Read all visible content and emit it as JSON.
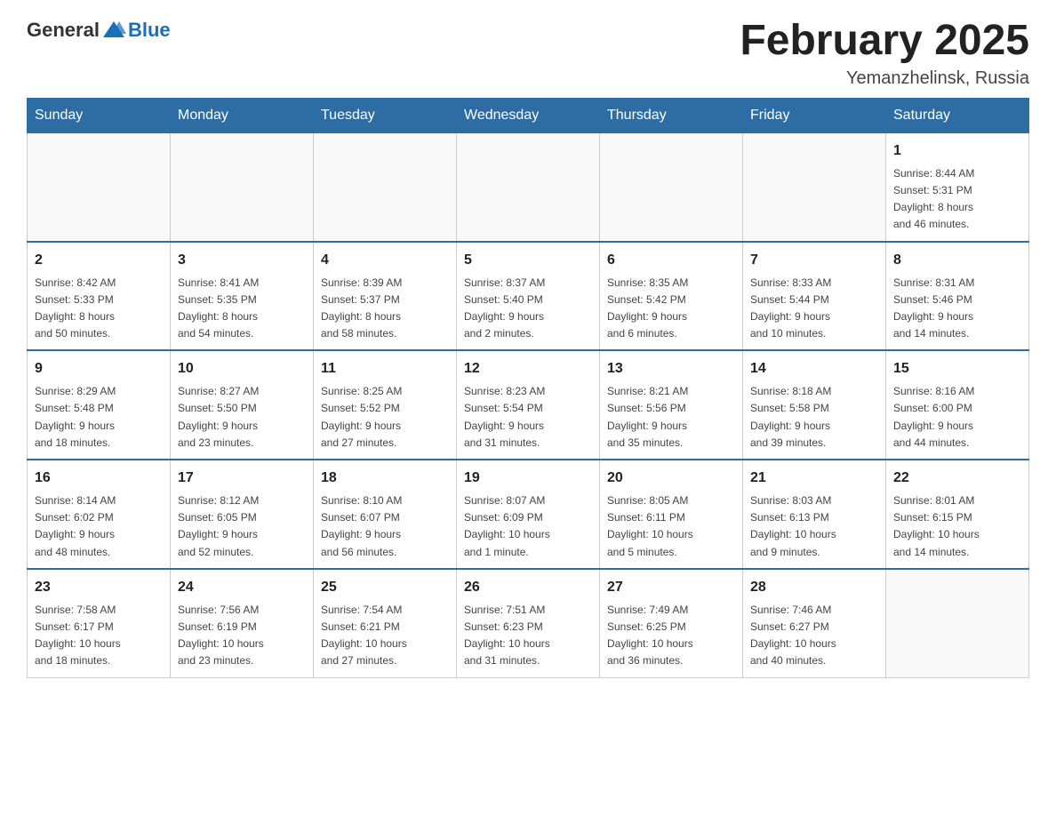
{
  "logo": {
    "general": "General",
    "blue": "Blue"
  },
  "header": {
    "month_title": "February 2025",
    "location": "Yemanzhelinsk, Russia"
  },
  "weekdays": [
    "Sunday",
    "Monday",
    "Tuesday",
    "Wednesday",
    "Thursday",
    "Friday",
    "Saturday"
  ],
  "weeks": [
    [
      {
        "day": "",
        "info": ""
      },
      {
        "day": "",
        "info": ""
      },
      {
        "day": "",
        "info": ""
      },
      {
        "day": "",
        "info": ""
      },
      {
        "day": "",
        "info": ""
      },
      {
        "day": "",
        "info": ""
      },
      {
        "day": "1",
        "info": "Sunrise: 8:44 AM\nSunset: 5:31 PM\nDaylight: 8 hours\nand 46 minutes."
      }
    ],
    [
      {
        "day": "2",
        "info": "Sunrise: 8:42 AM\nSunset: 5:33 PM\nDaylight: 8 hours\nand 50 minutes."
      },
      {
        "day": "3",
        "info": "Sunrise: 8:41 AM\nSunset: 5:35 PM\nDaylight: 8 hours\nand 54 minutes."
      },
      {
        "day": "4",
        "info": "Sunrise: 8:39 AM\nSunset: 5:37 PM\nDaylight: 8 hours\nand 58 minutes."
      },
      {
        "day": "5",
        "info": "Sunrise: 8:37 AM\nSunset: 5:40 PM\nDaylight: 9 hours\nand 2 minutes."
      },
      {
        "day": "6",
        "info": "Sunrise: 8:35 AM\nSunset: 5:42 PM\nDaylight: 9 hours\nand 6 minutes."
      },
      {
        "day": "7",
        "info": "Sunrise: 8:33 AM\nSunset: 5:44 PM\nDaylight: 9 hours\nand 10 minutes."
      },
      {
        "day": "8",
        "info": "Sunrise: 8:31 AM\nSunset: 5:46 PM\nDaylight: 9 hours\nand 14 minutes."
      }
    ],
    [
      {
        "day": "9",
        "info": "Sunrise: 8:29 AM\nSunset: 5:48 PM\nDaylight: 9 hours\nand 18 minutes."
      },
      {
        "day": "10",
        "info": "Sunrise: 8:27 AM\nSunset: 5:50 PM\nDaylight: 9 hours\nand 23 minutes."
      },
      {
        "day": "11",
        "info": "Sunrise: 8:25 AM\nSunset: 5:52 PM\nDaylight: 9 hours\nand 27 minutes."
      },
      {
        "day": "12",
        "info": "Sunrise: 8:23 AM\nSunset: 5:54 PM\nDaylight: 9 hours\nand 31 minutes."
      },
      {
        "day": "13",
        "info": "Sunrise: 8:21 AM\nSunset: 5:56 PM\nDaylight: 9 hours\nand 35 minutes."
      },
      {
        "day": "14",
        "info": "Sunrise: 8:18 AM\nSunset: 5:58 PM\nDaylight: 9 hours\nand 39 minutes."
      },
      {
        "day": "15",
        "info": "Sunrise: 8:16 AM\nSunset: 6:00 PM\nDaylight: 9 hours\nand 44 minutes."
      }
    ],
    [
      {
        "day": "16",
        "info": "Sunrise: 8:14 AM\nSunset: 6:02 PM\nDaylight: 9 hours\nand 48 minutes."
      },
      {
        "day": "17",
        "info": "Sunrise: 8:12 AM\nSunset: 6:05 PM\nDaylight: 9 hours\nand 52 minutes."
      },
      {
        "day": "18",
        "info": "Sunrise: 8:10 AM\nSunset: 6:07 PM\nDaylight: 9 hours\nand 56 minutes."
      },
      {
        "day": "19",
        "info": "Sunrise: 8:07 AM\nSunset: 6:09 PM\nDaylight: 10 hours\nand 1 minute."
      },
      {
        "day": "20",
        "info": "Sunrise: 8:05 AM\nSunset: 6:11 PM\nDaylight: 10 hours\nand 5 minutes."
      },
      {
        "day": "21",
        "info": "Sunrise: 8:03 AM\nSunset: 6:13 PM\nDaylight: 10 hours\nand 9 minutes."
      },
      {
        "day": "22",
        "info": "Sunrise: 8:01 AM\nSunset: 6:15 PM\nDaylight: 10 hours\nand 14 minutes."
      }
    ],
    [
      {
        "day": "23",
        "info": "Sunrise: 7:58 AM\nSunset: 6:17 PM\nDaylight: 10 hours\nand 18 minutes."
      },
      {
        "day": "24",
        "info": "Sunrise: 7:56 AM\nSunset: 6:19 PM\nDaylight: 10 hours\nand 23 minutes."
      },
      {
        "day": "25",
        "info": "Sunrise: 7:54 AM\nSunset: 6:21 PM\nDaylight: 10 hours\nand 27 minutes."
      },
      {
        "day": "26",
        "info": "Sunrise: 7:51 AM\nSunset: 6:23 PM\nDaylight: 10 hours\nand 31 minutes."
      },
      {
        "day": "27",
        "info": "Sunrise: 7:49 AM\nSunset: 6:25 PM\nDaylight: 10 hours\nand 36 minutes."
      },
      {
        "day": "28",
        "info": "Sunrise: 7:46 AM\nSunset: 6:27 PM\nDaylight: 10 hours\nand 40 minutes."
      },
      {
        "day": "",
        "info": ""
      }
    ]
  ]
}
